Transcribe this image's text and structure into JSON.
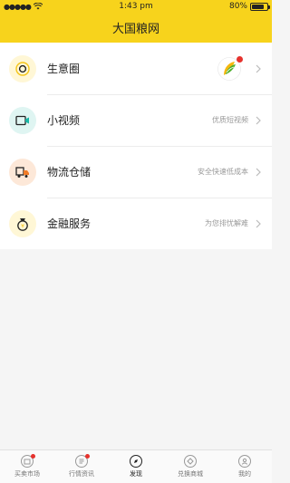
{
  "status": {
    "time": "1:43 pm",
    "battery": "80%",
    "battery_level": 0.8
  },
  "nav": {
    "title": "大国粮网"
  },
  "menu": [
    {
      "label": "生意圈",
      "sub": "",
      "icon": "camera-icon",
      "color": "#f5c518",
      "bg": "#fff7d6"
    },
    {
      "label": "小视频",
      "sub": "优质短视频",
      "icon": "video-camera-icon",
      "color": "#1bb8a6",
      "bg": "#dff5f2"
    },
    {
      "label": "物流仓储",
      "sub": "安全快速低成本",
      "icon": "truck-icon",
      "color": "#f07b26",
      "bg": "#fde8d8"
    },
    {
      "label": "金融服务",
      "sub": "为您排忧解难",
      "icon": "money-bag-icon",
      "color": "#f5c518",
      "bg": "#fff7d6"
    }
  ],
  "tabs": [
    {
      "label": "买卖市场",
      "icon": "market-icon",
      "dot": true,
      "active": false
    },
    {
      "label": "行情资讯",
      "icon": "news-icon",
      "dot": true,
      "active": false
    },
    {
      "label": "发现",
      "icon": "compass-icon",
      "dot": false,
      "active": true
    },
    {
      "label": "兑换商城",
      "icon": "exchange-icon",
      "dot": false,
      "active": false
    },
    {
      "label": "我的",
      "icon": "user-icon",
      "dot": false,
      "active": false
    }
  ],
  "colors": {
    "accent": "#f7d31c",
    "badge": "#e6322d"
  }
}
